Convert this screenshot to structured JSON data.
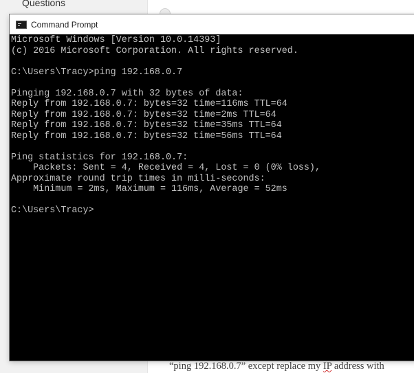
{
  "background": {
    "sidebar_label": "Questions",
    "article_text_before": "“ping 192.168.0.7” except replace my ",
    "article_text_spell": "IP",
    "article_text_after": " address with"
  },
  "window": {
    "title": "Command Prompt",
    "icon": "cmd-window-icon"
  },
  "console": {
    "lines": [
      "Microsoft Windows [Version 10.0.14393]",
      "(c) 2016 Microsoft Corporation. All rights reserved.",
      "",
      "C:\\Users\\Tracy>ping 192.168.0.7",
      "",
      "Pinging 192.168.0.7 with 32 bytes of data:",
      "Reply from 192.168.0.7: bytes=32 time=116ms TTL=64",
      "Reply from 192.168.0.7: bytes=32 time=2ms TTL=64",
      "Reply from 192.168.0.7: bytes=32 time=35ms TTL=64",
      "Reply from 192.168.0.7: bytes=32 time=56ms TTL=64",
      "",
      "Ping statistics for 192.168.0.7:",
      "    Packets: Sent = 4, Received = 4, Lost = 0 (0% loss),",
      "Approximate round trip times in milli-seconds:",
      "    Minimum = 2ms, Maximum = 116ms, Average = 52ms",
      "",
      "C:\\Users\\Tracy>"
    ]
  }
}
